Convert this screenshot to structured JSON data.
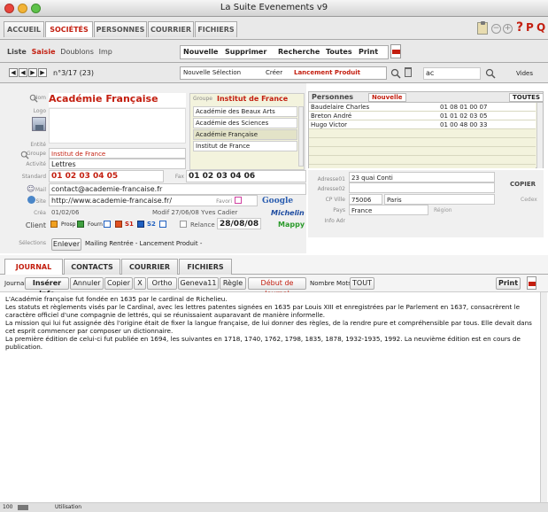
{
  "window": {
    "title": "La Suite Evenements v9"
  },
  "main_tabs": [
    "ACCUEIL",
    "SOCIÉTÉS",
    "PERSONNES",
    "COURRIER",
    "FICHIERS"
  ],
  "toolbar_icons": {
    "c1": "clipboard-icon",
    "c2": "minus-icon",
    "c3": "plus-icon",
    "q": "?",
    "p": "P",
    "q2": "Q"
  },
  "sub_tabs": [
    "Liste",
    "Saisie",
    "Doublons",
    "Imp"
  ],
  "actions": [
    "Nouvelle",
    "Supprimer",
    "Recherche",
    "Toutes",
    "Print"
  ],
  "nav": {
    "record": "n°3/17 (23)",
    "selection_name": "Nouvelle Sélection",
    "create_label": "Créer",
    "selection_value": "Lancement Produit",
    "search_value": "ac",
    "search_label": "Vides"
  },
  "company": {
    "label_nom": "Nom",
    "name": "Académie Française",
    "label_logo": "Logo",
    "label_entite": "Entité",
    "label_groupe": "Groupe",
    "groupe": "Institut de France",
    "label_activite": "Activité",
    "activite": "Lettres",
    "label_standard": "Standard",
    "standard": "01 02 03 04 05",
    "label_fax": "Fax",
    "fax": "01 02 03 04 06",
    "label_mail": "Mail",
    "mail": "contact@academie-francaise.fr",
    "label_site": "Site",
    "site": "http://www.academie-francaise.fr/",
    "label_favori": "Favori",
    "google": "Google",
    "label_cree": "Créa",
    "cree": "01/02/06",
    "modif": "Modif 27/06/08 Yves Cadier",
    "michelin": "Michelin",
    "label_client": "Client",
    "prosp": "Prosp",
    "fourn": "Fourn",
    "s1": "S1",
    "s2": "S2",
    "label_relance": "Relance",
    "relance": "28/08/08",
    "mappy": "Mappy",
    "label_selections": "Sélections",
    "enlever": "Enlever",
    "selections_text": "Mailing Rentrée - Lancement Produit -"
  },
  "group": {
    "label": "Groupe",
    "name": "Institut de France",
    "members": [
      "Académie des Beaux Arts",
      "Académie des Sciences",
      "Académie Française",
      "Institut de France"
    ]
  },
  "persons": {
    "title": "Personnes",
    "new": "Nouvelle",
    "all": "TOUTES",
    "rows": [
      {
        "name": "Baudelaire Charles",
        "phone": "01 08 01 00 07"
      },
      {
        "name": "Breton André",
        "phone": "01 01 02 03 05"
      },
      {
        "name": "Hugo Victor",
        "phone": "01 00 48 00 33"
      }
    ]
  },
  "address": {
    "label1": "Adresse01",
    "value1": "23 quai Conti",
    "label2": "Adresse02",
    "label_cp": "CP Ville",
    "cp": "75006",
    "ville": "Paris",
    "cedex": "Cedex",
    "label_pays": "Pays",
    "pays": "France",
    "region": "Région",
    "label_info": "Info Adr",
    "copier": "COPIER"
  },
  "bottom_tabs": [
    "JOURNAL",
    "CONTACTS",
    "COURRIER",
    "FICHIERS"
  ],
  "journal_toolbar": {
    "label": "Journal",
    "buttons": [
      "Insérer Info",
      "Annuler",
      "Copier",
      "X",
      "Ortho",
      "Geneva11",
      "Règle"
    ],
    "start": "Début de Journal",
    "words": "Nombre Mots",
    "all": "TOUT",
    "print": "Print"
  },
  "journal_text": "L'Académie française fut fondée en 1635 par le cardinal de Richelieu.\nLes statuts et règlements visés par le Cardinal, avec les lettres patentes signées en 1635 par Louis XIII et enregistrées par le Parlement en 1637, consacrèrent le caractère officiel d'une compagnie de lettrés, qui se réunissaient auparavant de manière informelle.\nLa mission qui lui fut assignée dès l'origine était de fixer la langue française, de lui donner des règles, de la rendre pure et compréhensible par tous. Elle devait dans cet esprit commencer par composer un dictionnaire.\nLa première édition de celui-ci fut publiée en 1694, les suivantes en 1718, 1740, 1762, 1798, 1835, 1878, 1932-1935, 1992. La neuvième édition est en cours de publication.",
  "status": {
    "zoom": "100",
    "mode": "Utilisation"
  },
  "colors": {
    "accent": "#c31e0f",
    "panel": "#f3f3dd"
  }
}
